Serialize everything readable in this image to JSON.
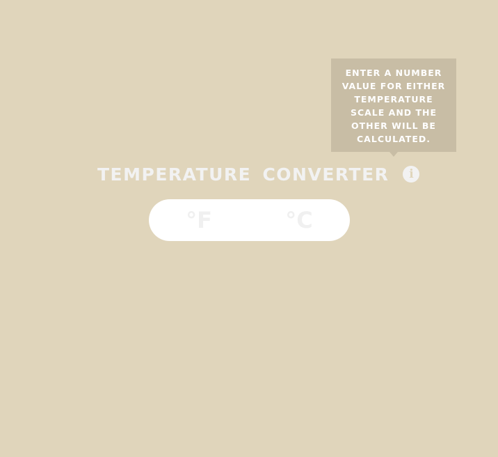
{
  "tooltip": {
    "text": "ENTER A NUMBER VALUE FOR EITHER TEMPERATURE SCALE AND THE OTHER WILL BE CALCULATED."
  },
  "header": {
    "title": "TEMPERATURE CONVERTER",
    "info_icon": "info-icon"
  },
  "converter": {
    "fahrenheit": {
      "value": "",
      "placeholder": "°F"
    },
    "celsius": {
      "value": "",
      "placeholder": "°C"
    }
  },
  "colors": {
    "background": "#e0d5bb",
    "tooltip": "#c8bda5",
    "text": "#f2f2f2",
    "input_bg": "#ffffff"
  }
}
